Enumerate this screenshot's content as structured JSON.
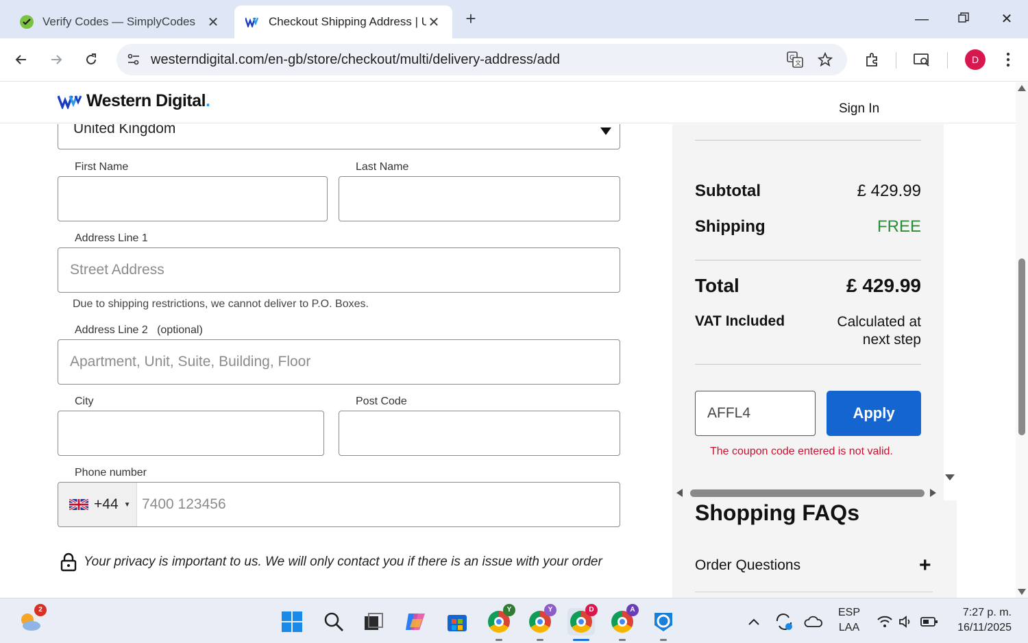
{
  "browser": {
    "tabs": [
      {
        "title": "Verify Codes — SimplyCodes",
        "active": false
      },
      {
        "title": "Checkout Shipping Address | United Kingdom",
        "active": true
      }
    ],
    "new_tab": "+",
    "url": "westerndigital.com/en-gb/store/checkout/multi/delivery-address/add",
    "profile_initial": "D"
  },
  "header": {
    "brand": "Western Digital",
    "brand_dot": ".",
    "sign_in": "Sign In"
  },
  "form": {
    "country": "United Kingdom",
    "first_name_label": "First Name",
    "last_name_label": "Last Name",
    "address1_label": "Address Line 1",
    "address1_placeholder": "Street Address",
    "po_box_note": "Due to shipping restrictions, we cannot deliver to P.O. Boxes.",
    "address2_label": "Address Line 2",
    "address2_optional": "(optional)",
    "address2_placeholder": "Apartment, Unit, Suite, Building, Floor",
    "city_label": "City",
    "postcode_label": "Post Code",
    "phone_label": "Phone number",
    "phone_code": "+44",
    "phone_placeholder": "7400 123456",
    "privacy_note": "Your privacy is important to us. We will only contact you if there is an issue with your order"
  },
  "summary": {
    "subtotal_label": "Subtotal",
    "subtotal_value": "£ 429.99",
    "shipping_label": "Shipping",
    "shipping_value": "FREE",
    "total_label": "Total",
    "total_value": "£ 429.99",
    "vat_label": "VAT Included",
    "vat_value_line1": "Calculated at",
    "vat_value_line2": "next step",
    "coupon_value": "AFFL4",
    "apply_label": "Apply",
    "coupon_error": "The coupon code entered is not valid."
  },
  "faq": {
    "title": "Shopping FAQs",
    "items": [
      {
        "label": "Order Questions"
      }
    ]
  },
  "taskbar": {
    "weather_badge": "2",
    "chrome_profiles": [
      "Y",
      "Y",
      "D",
      "A"
    ],
    "lang_line1": "ESP",
    "lang_line2": "LAA",
    "time": "7:27 p. m.",
    "date": "16/11/2025"
  },
  "colors": {
    "accent": "#1565d0",
    "free": "#2e8b3a",
    "error": "#c8102e",
    "tab_strip": "#dfe6f5"
  }
}
